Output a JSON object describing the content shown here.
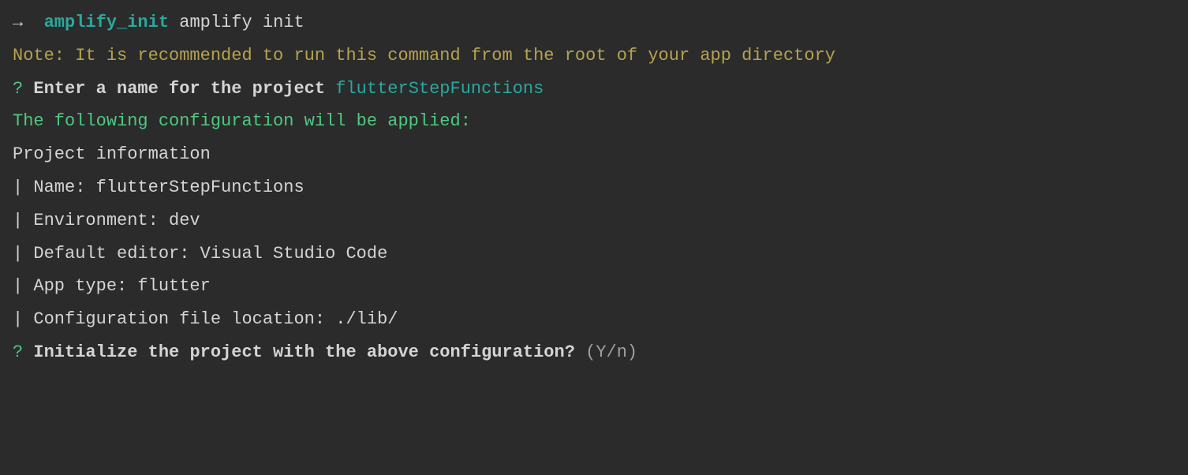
{
  "prompt": {
    "arrow": "→  ",
    "dir": "amplify_init",
    "command": " amplify init"
  },
  "note": "Note: It is recommended to run this command from the root of your app directory",
  "q1": {
    "marker": "?",
    "text": " Enter a name for the project ",
    "answer": "flutterStepFunctions"
  },
  "applied": "The following configuration will be applied:",
  "blank": "",
  "info_header": "Project information",
  "info": {
    "name": "| Name: flutterStepFunctions",
    "env": "| Environment: dev",
    "editor": "| Default editor: Visual Studio Code",
    "apptype": "| App type: flutter",
    "config": "| Configuration file location: ./lib/"
  },
  "q2": {
    "marker": "?",
    "text": " Initialize the project with the above configuration? ",
    "hint": "(Y/n) "
  }
}
